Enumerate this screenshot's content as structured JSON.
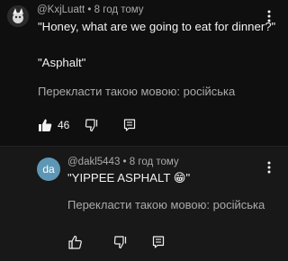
{
  "comments": [
    {
      "author": "@KxjLuatt",
      "time": "8 год тому",
      "lines": [
        "\"Honey, what are we going to eat for dinner?\"",
        "\"Asphalt\""
      ],
      "translate_label": "Перекласти такою мовою: російська",
      "like_count": "46"
    },
    {
      "avatar_initials": "da",
      "author": "@dakl5443",
      "time": "8 год тому",
      "text": "\"YIPPEE ASPHALT 😁\"",
      "translate_label": "Перекласти такою мовою: російська"
    }
  ],
  "meta_separator": " • ",
  "icons": {
    "like": "thumbs-up-icon",
    "dislike": "thumbs-down-icon",
    "reply": "reply-icon",
    "more": "more-vertical-icon"
  },
  "colors": {
    "background": "#0f0f0f",
    "reply_background": "#181818",
    "text": "#f1f1f1",
    "secondary_text": "#aaaaaa",
    "avatar_reply": "#5e97b5"
  }
}
